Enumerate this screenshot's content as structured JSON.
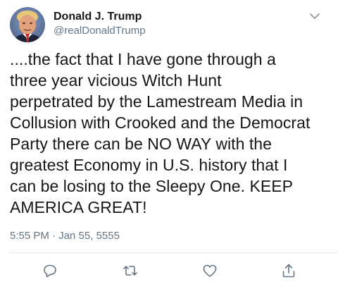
{
  "tweet": {
    "author": {
      "display_name": "Donald J. Trump",
      "handle": "@realDonaldTrump",
      "avatar": "avatar-photo"
    },
    "text": "....the fact that I have gone through a\nthree year vicious Witch Hunt\nperpetrated by the Lamestream Media in\nCollusion with Crooked and the Democrat\nParty there can be NO WAY with the\ngreatest Economy in U.S. history that I\ncan be losing to the Sleepy One. KEEP\nAMERICA GREAT!",
    "timestamp": "5:55 PM · Jan 55, 5555",
    "menu_icon": "chevron-down-icon",
    "actions": [
      {
        "name": "reply",
        "icon": "reply-icon"
      },
      {
        "name": "retweet",
        "icon": "retweet-icon"
      },
      {
        "name": "like",
        "icon": "heart-icon"
      },
      {
        "name": "share",
        "icon": "share-icon"
      }
    ]
  },
  "colors": {
    "text": "#14171a",
    "secondary": "#657786",
    "icon": "#657786",
    "divider": "#e1e8ed"
  }
}
